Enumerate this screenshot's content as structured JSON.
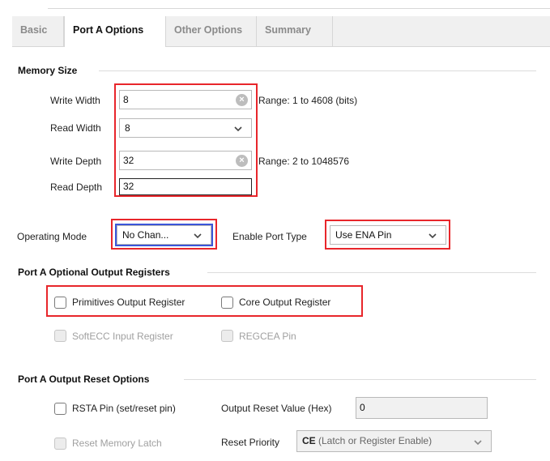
{
  "tabs": [
    {
      "label": "Basic",
      "active": false
    },
    {
      "label": "Port A Options",
      "active": true
    },
    {
      "label": "Other Options",
      "active": false
    },
    {
      "label": "Summary",
      "active": false
    }
  ],
  "memory_size": {
    "title": "Memory Size",
    "write_width": {
      "label": "Write Width",
      "value": "8",
      "range": "Range: 1 to 4608 (bits)"
    },
    "read_width": {
      "label": "Read Width",
      "value": "8"
    },
    "write_depth": {
      "label": "Write Depth",
      "value": "32",
      "range": "Range: 2 to 1048576"
    },
    "read_depth": {
      "label": "Read Depth",
      "value": "32"
    }
  },
  "operating_mode": {
    "label": "Operating Mode",
    "value": "No Chan..."
  },
  "enable_port_type": {
    "label": "Enable Port Type",
    "value": "Use ENA Pin"
  },
  "optional_output": {
    "title": "Port A Optional Output Registers",
    "primitives": {
      "label": "Primitives Output Register",
      "checked": false
    },
    "core": {
      "label": "Core Output Register",
      "checked": false
    },
    "softecc": {
      "label": "SoftECC Input Register",
      "checked": false,
      "disabled": true
    },
    "regcea": {
      "label": "REGCEA Pin",
      "checked": false,
      "disabled": true
    }
  },
  "reset_options": {
    "title": "Port A Output Reset Options",
    "rsta": {
      "label": "RSTA Pin (set/reset pin)",
      "checked": false
    },
    "reset_value": {
      "label": "Output Reset Value (Hex)",
      "value": "0"
    },
    "reset_latch": {
      "label": "Reset Memory Latch",
      "checked": false,
      "disabled": true
    },
    "reset_priority": {
      "label": "Reset Priority",
      "value_bold": "CE",
      "value_rest": " (Latch or Register Enable)"
    }
  },
  "colors": {
    "highlight": "#e8262b",
    "focus": "#3b55d9"
  }
}
